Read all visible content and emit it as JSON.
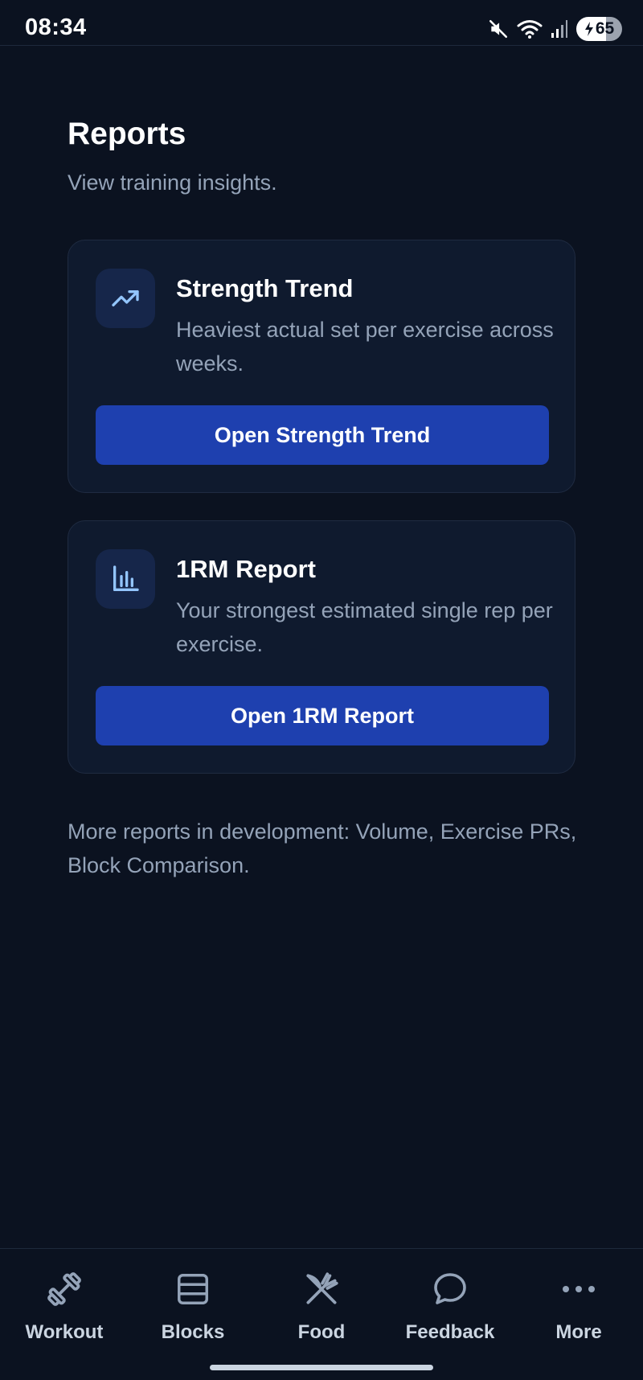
{
  "status_bar": {
    "time": "08:34",
    "battery_level": "65",
    "icons": [
      "mute-icon",
      "wifi-icon",
      "signal-icon",
      "battery-charging-icon"
    ]
  },
  "header": {
    "title": "Reports",
    "subtitle": "View training insights."
  },
  "cards": [
    {
      "icon": "trending-up-icon",
      "title": "Strength Trend",
      "description": "Heaviest actual set per exercise across weeks.",
      "button_label": "Open Strength Trend"
    },
    {
      "icon": "bar-chart-icon",
      "title": "1RM Report",
      "description": "Your strongest estimated single rep per exercise.",
      "button_label": "Open 1RM Report"
    }
  ],
  "note": "More reports in development: Volume, Exercise PRs, Block Comparison.",
  "bottom_nav": {
    "items": [
      {
        "label": "Workout",
        "icon": "dumbbell-icon"
      },
      {
        "label": "Blocks",
        "icon": "blocks-icon"
      },
      {
        "label": "Food",
        "icon": "fork-knife-icon"
      },
      {
        "label": "Feedback",
        "icon": "chat-bubble-icon"
      },
      {
        "label": "More",
        "icon": "more-dots-icon"
      }
    ]
  },
  "colors": {
    "background": "#0b1220",
    "card": "#0f1a2e",
    "primary_button": "#1e40af",
    "accent_icon": "#93c5fd",
    "muted_text": "#94a3b8"
  }
}
